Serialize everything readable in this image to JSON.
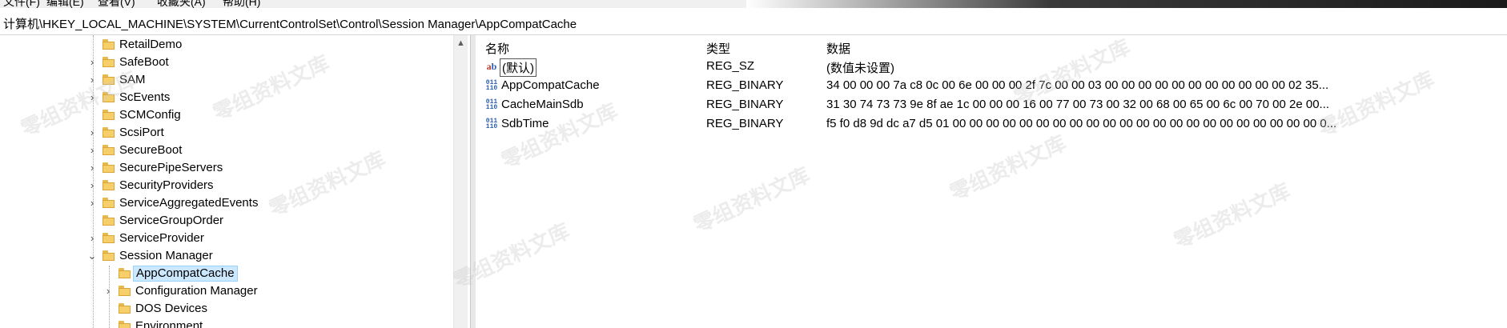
{
  "menubar": {
    "items": [
      "文件(F)",
      "编辑(E)",
      "查看(V)",
      "收藏夹(A)",
      "帮助(H)"
    ]
  },
  "address": {
    "path": "计算机\\HKEY_LOCAL_MACHINE\\SYSTEM\\CurrentControlSet\\Control\\Session Manager\\AppCompatCache"
  },
  "tree": {
    "items": [
      {
        "label": "RetailDemo",
        "expander": ""
      },
      {
        "label": "SafeBoot",
        "expander": "›"
      },
      {
        "label": "SAM",
        "expander": "›"
      },
      {
        "label": "ScEvents",
        "expander": "›"
      },
      {
        "label": "SCMConfig",
        "expander": ""
      },
      {
        "label": "ScsiPort",
        "expander": "›"
      },
      {
        "label": "SecureBoot",
        "expander": "›"
      },
      {
        "label": "SecurePipeServers",
        "expander": "›"
      },
      {
        "label": "SecurityProviders",
        "expander": "›"
      },
      {
        "label": "ServiceAggregatedEvents",
        "expander": "›"
      },
      {
        "label": "ServiceGroupOrder",
        "expander": ""
      },
      {
        "label": "ServiceProvider",
        "expander": "›"
      },
      {
        "label": "Session Manager",
        "expander": "⌄"
      },
      {
        "label": "AppCompatCache",
        "expander": ""
      },
      {
        "label": "Configuration Manager",
        "expander": "›"
      },
      {
        "label": "DOS Devices",
        "expander": ""
      },
      {
        "label": "Environment",
        "expander": ""
      }
    ]
  },
  "values": {
    "headers": {
      "name": "名称",
      "type": "类型",
      "data": "数据"
    },
    "rows": [
      {
        "name": "(默认)",
        "type": "REG_SZ",
        "data": "(数值未设置)",
        "icon": "string-value-icon"
      },
      {
        "name": "AppCompatCache",
        "type": "REG_BINARY",
        "data": "34 00 00 00 7a c8 0c 00 6e 00 00 00 2f 7c 00 00 03 00 00 00 00 00 00 00 00 00 00 00 02 35...",
        "icon": "binary-value-icon"
      },
      {
        "name": "CacheMainSdb",
        "type": "REG_BINARY",
        "data": "31 30 74 73 73 9e 8f ae 1c 00 00 00 16 00 77 00 73 00 32 00 68 00 65 00 6c 00 70 00 2e 00...",
        "icon": "binary-value-icon"
      },
      {
        "name": "SdbTime",
        "type": "REG_BINARY",
        "data": "f5 f0 d8 9d dc a7 d5 01 00 00 00 00 00 00 00 00 00 00 00 00 00 00 00 00 00 00 00 00 00 00 0...",
        "icon": "binary-value-icon"
      }
    ]
  },
  "watermark": {
    "text": "零组资料文库"
  },
  "colors": {
    "selection": "#cce8ff",
    "folder": "#f6cf6a"
  }
}
